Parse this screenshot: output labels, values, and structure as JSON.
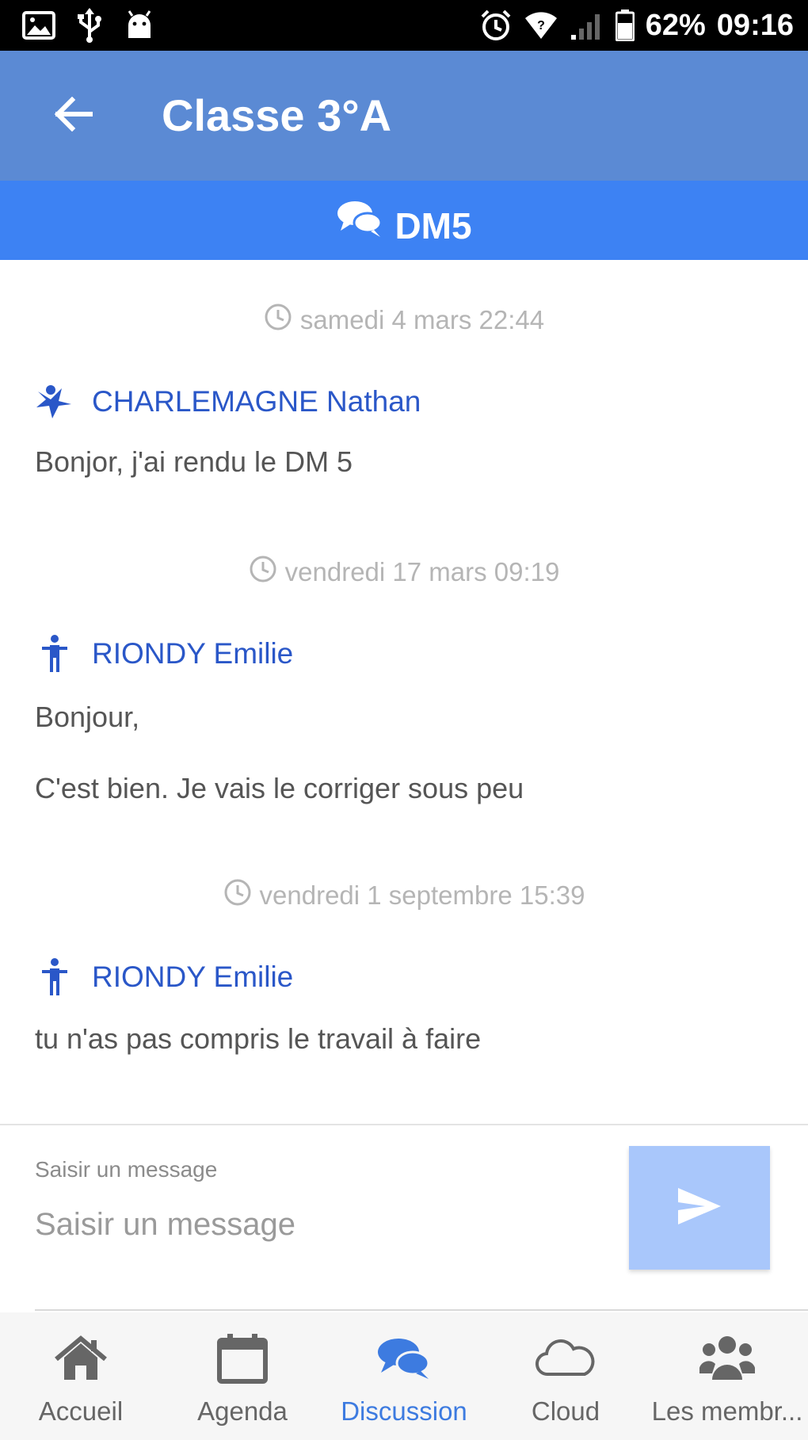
{
  "status_bar": {
    "battery": "62%",
    "time": "09:16",
    "icons": [
      "image-icon",
      "usb-icon",
      "android-icon",
      "alarm-icon",
      "wifi-icon",
      "signal-icon",
      "battery-icon"
    ]
  },
  "header": {
    "title": "Classe 3°A",
    "back_icon": "arrow-left-icon"
  },
  "discussion": {
    "title": "DM5",
    "icon": "chat-bubbles-icon"
  },
  "messages": [
    {
      "timestamp": "samedi 4 mars 22:44",
      "author": "CHARLEMAGNE Nathan",
      "author_icon": "student-icon",
      "lines": [
        "Bonjor, j'ai rendu le DM 5"
      ]
    },
    {
      "timestamp": "vendredi 17 mars 09:19",
      "author": "RIONDY Emilie",
      "author_icon": "teacher-icon",
      "lines": [
        "Bonjour,",
        "C'est bien. Je vais le corriger sous peu"
      ]
    },
    {
      "timestamp": "vendredi 1 septembre 15:39",
      "author": "RIONDY Emilie",
      "author_icon": "teacher-icon",
      "lines": [
        "tu n'as pas compris le travail à faire"
      ]
    }
  ],
  "composer": {
    "label": "Saisir un message",
    "placeholder": "Saisir un message",
    "send_icon": "send-icon"
  },
  "bottom_nav": [
    {
      "label": "Accueil",
      "icon": "home-icon",
      "active": false
    },
    {
      "label": "Agenda",
      "icon": "calendar-icon",
      "active": false
    },
    {
      "label": "Discussion",
      "icon": "chat-bubbles-icon",
      "active": true
    },
    {
      "label": "Cloud",
      "icon": "cloud-icon",
      "active": false
    },
    {
      "label": "Les membr...",
      "icon": "members-icon",
      "active": false
    }
  ],
  "colors": {
    "appbar": "#5b8ad4",
    "subheader": "#3d82f3",
    "author": "#2a57c8",
    "active_nav": "#3d7be0",
    "send_button": "#a9c7fb"
  }
}
